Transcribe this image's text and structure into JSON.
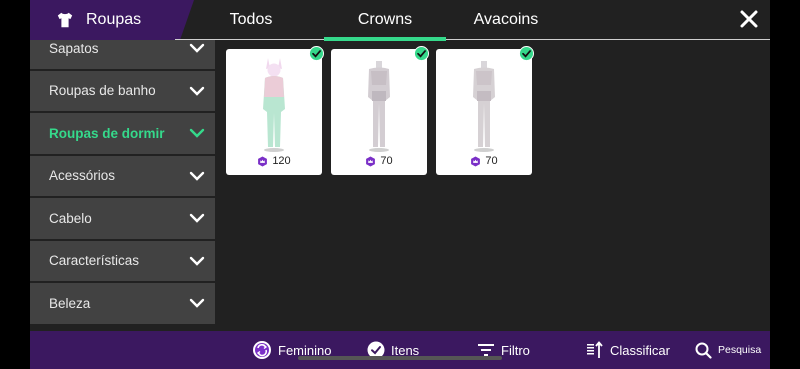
{
  "header": {
    "category_title": "Roupas",
    "category_icon": "shirt-icon",
    "tabs": [
      {
        "label": "Todos",
        "active": false
      },
      {
        "label": "Crowns",
        "active": true
      },
      {
        "label": "Avacoins",
        "active": false
      }
    ],
    "close_icon": "close-icon"
  },
  "sidebar": {
    "items": [
      {
        "label": "Sapatos",
        "active": false
      },
      {
        "label": "Roupas de banho",
        "active": false
      },
      {
        "label": "Roupas de dormir",
        "active": true
      },
      {
        "label": "Acessórios",
        "active": false
      },
      {
        "label": "Cabelo",
        "active": false
      },
      {
        "label": "Características",
        "active": false
      },
      {
        "label": "Beleza",
        "active": false
      }
    ]
  },
  "items": [
    {
      "price": "120",
      "currency_icon": "crown-coin-icon",
      "owned": true,
      "outfit": "bunny-onesie"
    },
    {
      "price": "70",
      "currency_icon": "crown-coin-icon",
      "owned": true,
      "outfit": "sleepwear-set"
    },
    {
      "price": "70",
      "currency_icon": "crown-coin-icon",
      "owned": true,
      "outfit": "sleepwear-set"
    }
  ],
  "bottombar": {
    "gender": "Feminino",
    "items": "Itens",
    "filter": "Filtro",
    "sort": "Classificar",
    "search": "Pesquisa"
  },
  "colors": {
    "accent": "#35d98b",
    "brand_purple": "#3b1860",
    "panel_bg": "#212121",
    "sidebar_item_bg": "#424242",
    "crown_coin": "#7a2fc7"
  }
}
